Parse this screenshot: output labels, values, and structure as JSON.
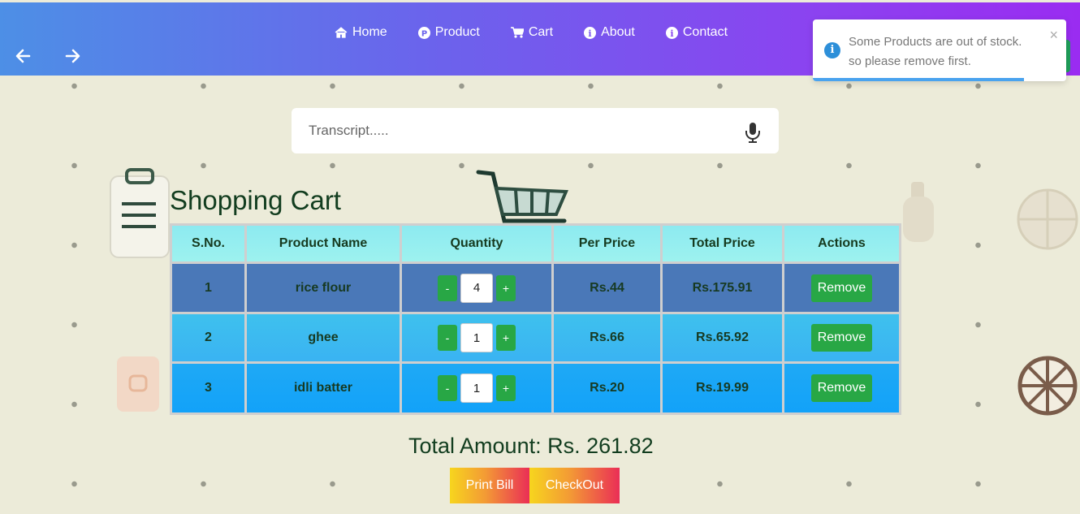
{
  "nav": {
    "back_icon": "arrow-left-icon",
    "forward_icon": "arrow-right-icon",
    "links": [
      {
        "label": "Home",
        "icon": "home-icon"
      },
      {
        "label": "Product",
        "icon": "product-icon"
      },
      {
        "label": "Cart",
        "icon": "cart-icon"
      },
      {
        "label": "About",
        "icon": "info-icon"
      },
      {
        "label": "Contact",
        "icon": "info-icon"
      }
    ]
  },
  "toast": {
    "line1": "Some Products are out of stock.",
    "line2": "so please remove first.",
    "close": "×",
    "icon": "info-icon",
    "color": "#2d8fd9"
  },
  "search": {
    "placeholder": "Transcript.....",
    "icon": "microphone-icon"
  },
  "cart": {
    "title": "Shopping Cart",
    "headers": [
      "S.No.",
      "Product Name",
      "Quantity",
      "Per Price",
      "Total Price",
      "Actions"
    ],
    "rows": [
      {
        "sno": "1",
        "name": "rice flour",
        "qty": "4",
        "per_price": "Rs.44",
        "total_price": "Rs.175.91",
        "action": "Remove"
      },
      {
        "sno": "2",
        "name": "ghee",
        "qty": "1",
        "per_price": "Rs.66",
        "total_price": "Rs.65.92",
        "action": "Remove"
      },
      {
        "sno": "3",
        "name": "idli batter",
        "qty": "1",
        "per_price": "Rs.20",
        "total_price": "Rs.19.99",
        "action": "Remove"
      }
    ],
    "decrement": "-",
    "increment": "+",
    "total_label": "Total Amount: Rs. 261.82",
    "print_label": "Print Bill",
    "checkout_label": "CheckOut"
  },
  "colors": {
    "accent_green": "#28a745",
    "nav_gradient_start": "#4d8fe6",
    "nav_gradient_end": "#9a2cf1"
  }
}
